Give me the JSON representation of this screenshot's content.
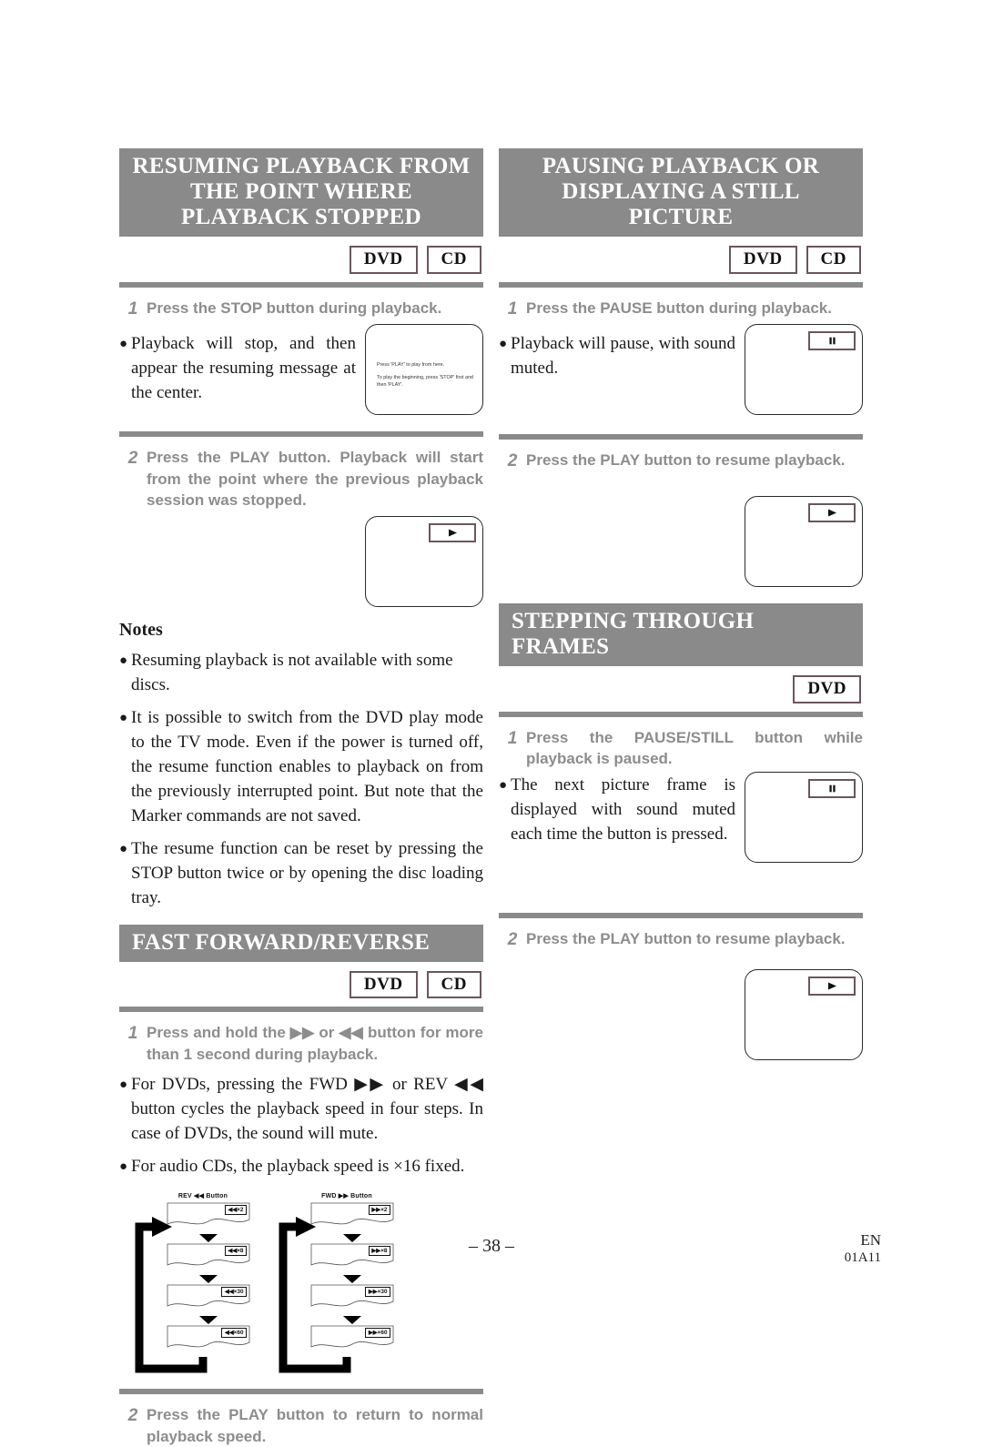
{
  "document": {
    "page_number": "– 38 –",
    "footer_language": "EN",
    "footer_code": "01A11"
  },
  "sections": {
    "resuming": {
      "title": "RESUMING PLAYBACK FROM THE POINT WHERE PLAYBACK STOPPED",
      "title_line1": "RESUMING PLAYBACK FROM",
      "title_line2": "THE POINT WHERE",
      "title_line3": "PLAYBACK STOPPED",
      "badges": [
        "DVD",
        "CD"
      ],
      "step1": {
        "num": "1",
        "text": "Press the STOP button during playback.",
        "bullet": "Playback will stop, and then appear the resuming message at the center."
      },
      "screen1": {
        "message_line1": "Press 'PLAY' to play from here.",
        "message_line2": "To play the beginning, press 'STOP' first and then 'PLAY'."
      },
      "step2": {
        "num": "2",
        "text": "Press the PLAY button. Playback will start from the point where the previous playback session was stopped."
      },
      "screen2": {
        "osd": "play-icon"
      }
    },
    "notes": {
      "heading": "Notes",
      "items": [
        "Resuming playback is not available with some discs.",
        "It is possible to switch from the DVD play mode to the TV mode. Even if the power is turned off, the resume function enables to playback on from the previously interrupted point. But note that the Marker commands are not saved.",
        "The resume function can be reset by pressing the STOP button twice or by opening the disc loading tray."
      ]
    },
    "fast_forward": {
      "title": "FAST FORWARD/REVERSE",
      "badges": [
        "DVD",
        "CD"
      ],
      "step1": {
        "num": "1",
        "text_part1": "Press and hold the ",
        "text_part2": " or ",
        "text_part3": " button for more than 1 second during playback."
      },
      "bullets": [
        "For DVDs, pressing the FWD ▶▶ or REV ◀◀ button cycles the playback speed in four steps. In case of DVDs, the sound will mute.",
        "For audio CDs, the playback speed is ×16 fixed."
      ],
      "diagram": {
        "rev_caption": "REV ◀◀ Button",
        "fwd_caption": "FWD ▶▶ Button",
        "rev_speeds": [
          "◀◀×2",
          "◀◀×8",
          "◀◀×30",
          "◀◀×60"
        ],
        "fwd_speeds": [
          "▶▶×2",
          "▶▶×8",
          "▶▶×30",
          "▶▶×60"
        ]
      },
      "step2": {
        "num": "2",
        "text": "Press the PLAY button to return to normal playback speed."
      }
    },
    "pausing": {
      "title": "PAUSING PLAYBACK OR DISPLAYING A STILL PICTURE",
      "title_line1": "PAUSING PLAYBACK OR",
      "title_line2": "DISPLAYING A STILL PICTURE",
      "badges": [
        "DVD",
        "CD"
      ],
      "step1": {
        "num": "1",
        "text": "Press the PAUSE button during playback.",
        "bullet": "Playback will pause, with sound muted."
      },
      "screen1": {
        "osd": "pause-icon"
      },
      "step2": {
        "num": "2",
        "text": "Press the PLAY button to resume playback."
      },
      "screen2": {
        "osd": "play-icon"
      }
    },
    "stepping": {
      "title": "STEPPING THROUGH FRAMES",
      "badges": [
        "DVD"
      ],
      "step1": {
        "num": "1",
        "text": "Press the PAUSE/STILL button while playback is paused.",
        "bullet": "The next picture frame is displayed with sound muted each time the button is pressed."
      },
      "screen1": {
        "osd": "pause-icon"
      },
      "step2": {
        "num": "2",
        "text": "Press the PLAY button to resume playback."
      },
      "screen2": {
        "osd": "play-icon"
      }
    }
  },
  "colors": {
    "header_bar": "#8a8a8a",
    "step_text": "#8d8d8d",
    "badge_border": "#6a5560",
    "body_text": "#1a1a1a"
  }
}
